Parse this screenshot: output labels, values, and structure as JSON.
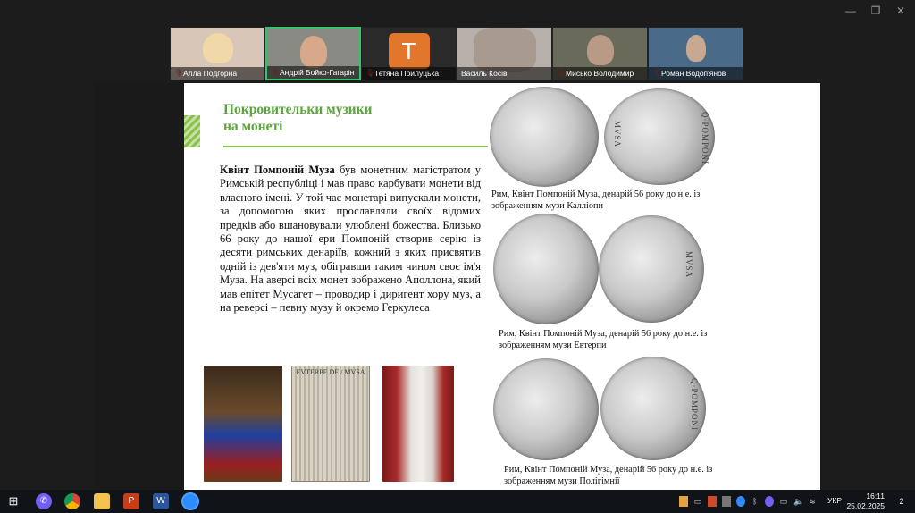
{
  "window_controls": {
    "minimize": "—",
    "restore": "❐",
    "close": "✕"
  },
  "participants": [
    {
      "name": "Алла Подгорна",
      "muted": true
    },
    {
      "name": "Андрій Бойко-Гагарін",
      "muted": true,
      "active": true
    },
    {
      "name": "Тетяна Прилуцька",
      "muted": true,
      "initial": "Т"
    },
    {
      "name": "Василь Косів",
      "muted": false
    },
    {
      "name": "Мисько Володимир",
      "muted": true
    },
    {
      "name": "Роман Водоп'янов",
      "muted": true
    }
  ],
  "slide": {
    "title_line1": "Покровительки музики",
    "title_line2": "на монеті",
    "body_bold": "Квінт Помпоній Муза",
    "body_rest": " був монетним магістратом у Римській республіці і мав право карбувати монети від власного імені. У той час монетарі випускали монети, за допомогою яких прославляли своїх відомих предків або вшановували улюблені божества. Близько 66 року до нашої ери Помпоній створив серію із десяти римських денаріїв, кожний з яких присвятив одній із дев'яти муз, обігравши таким чином своє ім'я Муза. На аверсі всіх монет зображено Аполлона, який мав епітет Мусагет – проводир і диригент хору муз, а на реверсі – певну музу й окремо Геркулеса",
    "engraving_caption": "EVTERPE DE / MVSA",
    "coin_legends": [
      "Q·POMPONI",
      "MVSA",
      "MVSA",
      "Q·POMPONI"
    ],
    "captions": [
      "Рим, Квінт Помпоній Муза, денарій 56 року до н.е. із зображенням музи Калліопи",
      "Рим, Квінт Помпоній Муза, денарій 56 року до н.е. із зображенням музи Евтерпи",
      "Рим, Квінт Помпоній Муза, денарій 56 року до н.е. із зображенням музи Полігімнії"
    ]
  },
  "taskbar": {
    "lang": "УКР",
    "time": "16:11",
    "date": "25.02.2025",
    "notifications": "2"
  }
}
